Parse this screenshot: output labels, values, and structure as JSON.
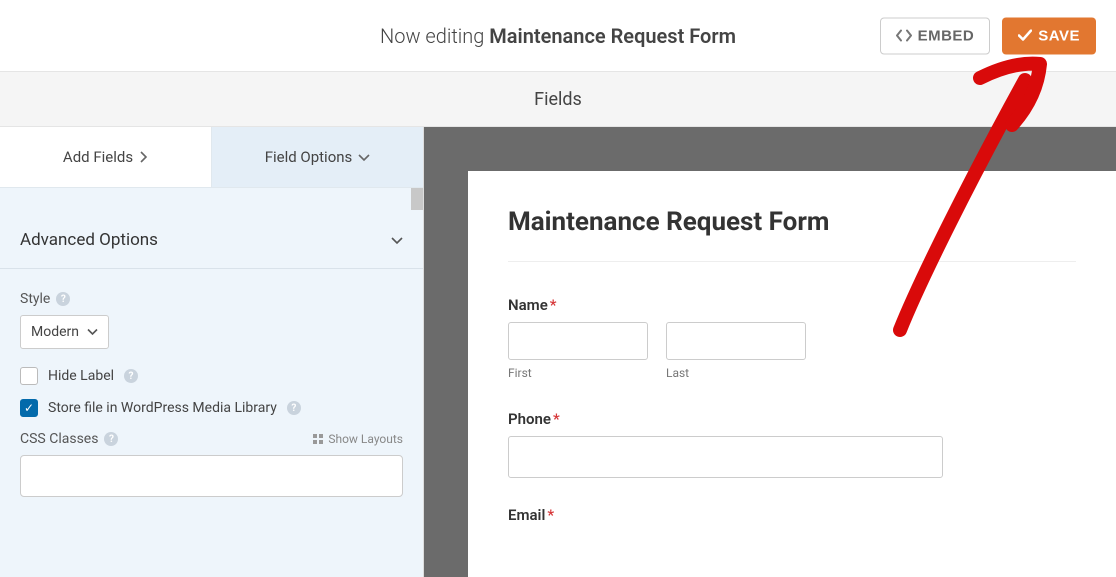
{
  "header": {
    "editing_prefix": "Now editing ",
    "form_name": "Maintenance Request Form",
    "embed_label": "EMBED",
    "save_label": "SAVE"
  },
  "fields_title": "Fields",
  "sidebar": {
    "tabs": {
      "add_fields": "Add Fields",
      "field_options": "Field Options"
    },
    "section_title": "Advanced Options",
    "style_label": "Style",
    "style_value": "Modern",
    "hide_label": "Hide Label",
    "store_file": "Store file in WordPress Media Library",
    "css_classes_label": "CSS Classes",
    "show_layouts": "Show Layouts",
    "css_value": ""
  },
  "form": {
    "title": "Maintenance Request Form",
    "name_label": "Name",
    "name_first": "First",
    "name_last": "Last",
    "phone_label": "Phone",
    "email_label": "Email"
  }
}
